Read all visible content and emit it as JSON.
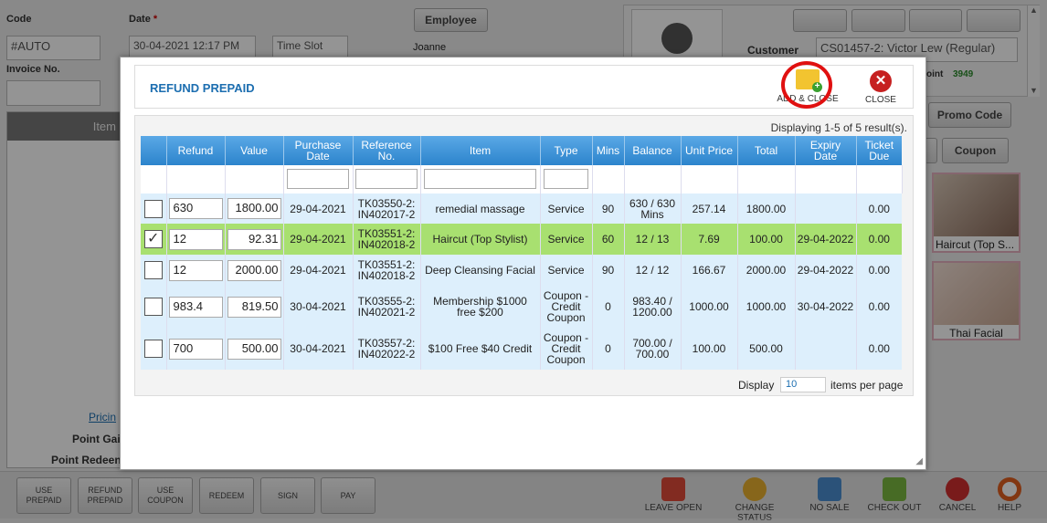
{
  "form": {
    "code_label": "Code",
    "code_value": "#AUTO",
    "date_label": "Date",
    "date_required": "*",
    "date_value": "30-04-2021 12:17 PM",
    "time_slot": "Time Slot",
    "employee_button": "Employee",
    "employee_name": "Joanne",
    "invoice_label": "Invoice No.",
    "customer_label": "Customer",
    "customer_value": "CS01457-2: Victor Lew (Regular)",
    "point_label": "oint",
    "point_value": "3949",
    "item_header": "Item",
    "pricing_link": "Pricin",
    "point_gain": "Point Gai",
    "point_redeem": "Point Redeen",
    "promo_code": "Promo Code",
    "coupon": "Coupon"
  },
  "side_cards": [
    {
      "label": "Haircut (Top S..."
    },
    {
      "label": "Thai Facial"
    }
  ],
  "modal": {
    "title": "REFUND PREPAID",
    "add_close": "ADD & CLOSE",
    "close": "CLOSE",
    "displaying": "Displaying 1-5 of 5 result(s).",
    "footer_display": "Display",
    "per_page_value": "10",
    "footer_items": "items per page"
  },
  "table": {
    "headers": [
      "",
      "Refund",
      "Value",
      "Purchase Date",
      "Reference No.",
      "Item",
      "Type",
      "Mins",
      "Balance",
      "Unit Price",
      "Total",
      "Expiry Date",
      "Ticket Due"
    ],
    "rows": [
      {
        "checked": false,
        "refund": "630",
        "value": "1800.00",
        "purchase": "29-04-2021",
        "ref": "TK03550-2: IN402017-2",
        "item": "remedial massage",
        "type": "Service",
        "mins": "90",
        "balance": "630 / 630 Mins",
        "unit": "257.14",
        "total": "1800.00",
        "expiry": "",
        "due": "0.00"
      },
      {
        "checked": true,
        "refund": "12",
        "value": "92.31",
        "purchase": "29-04-2021",
        "ref": "TK03551-2: IN402018-2",
        "item": "Haircut (Top Stylist)",
        "type": "Service",
        "mins": "60",
        "balance": "12 / 13",
        "unit": "7.69",
        "total": "100.00",
        "expiry": "29-04-2022",
        "due": "0.00"
      },
      {
        "checked": false,
        "refund": "12",
        "value": "2000.00",
        "purchase": "29-04-2021",
        "ref": "TK03551-2: IN402018-2",
        "item": "Deep Cleansing Facial",
        "type": "Service",
        "mins": "90",
        "balance": "12 / 12",
        "unit": "166.67",
        "total": "2000.00",
        "expiry": "29-04-2022",
        "due": "0.00"
      },
      {
        "checked": false,
        "refund": "983.4",
        "value": "819.50",
        "purchase": "30-04-2021",
        "ref": "TK03555-2: IN402021-2",
        "item": "Membership $1000 free $200",
        "type": "Coupon - Credit Coupon",
        "mins": "0",
        "balance": "983.40 / 1200.00",
        "unit": "1000.00",
        "total": "1000.00",
        "expiry": "30-04-2022",
        "due": "0.00"
      },
      {
        "checked": false,
        "refund": "700",
        "value": "500.00",
        "purchase": "30-04-2021",
        "ref": "TK03557-2: IN402022-2",
        "item": "$100 Free $40 Credit",
        "type": "Coupon - Credit Coupon",
        "mins": "0",
        "balance": "700.00 / 700.00",
        "unit": "100.00",
        "total": "500.00",
        "expiry": "",
        "due": "0.00"
      }
    ]
  },
  "bottom": {
    "buttons": [
      "USE PREPAID",
      "REFUND PREPAID",
      "USE COUPON",
      "REDEEM",
      "SIGN",
      "PAY"
    ],
    "icons": [
      "LEAVE OPEN",
      "CHANGE STATUS",
      "NO SALE",
      "CHECK OUT",
      "CANCEL",
      "HELP"
    ]
  },
  "colors": {
    "accent": "#2c84cc",
    "selected_row": "#a8e070",
    "highlight_circle": "#e01010"
  }
}
